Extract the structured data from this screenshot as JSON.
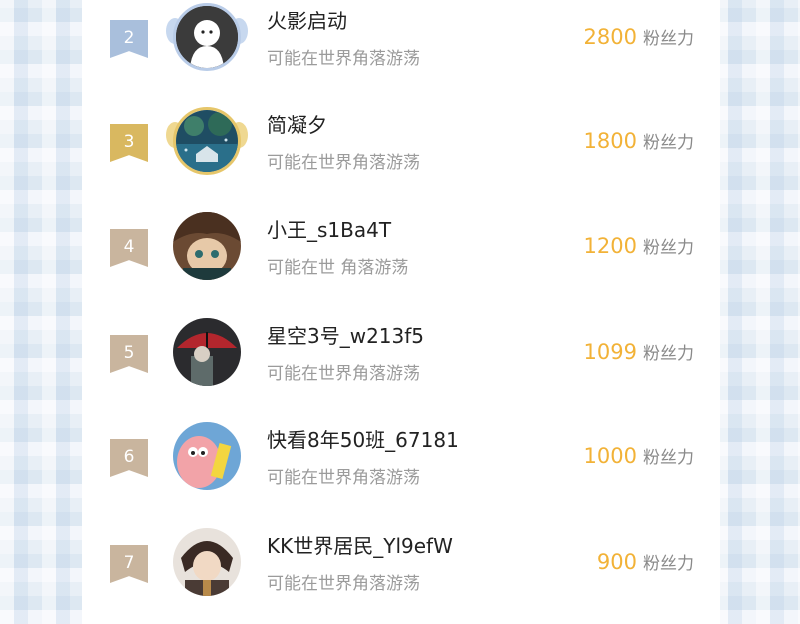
{
  "colors": {
    "accent_gold": "#f2b237",
    "rank_silver": "#a9bfdc",
    "rank_bronze": "#d9b860",
    "rank_other": "#c9b59e"
  },
  "description_text": "可能在世界角落游荡",
  "fans_label": "粉丝力",
  "ranking": [
    {
      "rank": "2",
      "name": "火影启动",
      "description": "可能在世界角落游荡",
      "fans": "2800",
      "fans_label": "粉丝力",
      "avatar_icon": "ghost-avatar-icon"
    },
    {
      "rank": "3",
      "name": "简凝夕",
      "description": "可能在世界角落游荡",
      "fans": "1800",
      "fans_label": "粉丝力",
      "avatar_icon": "scenery-avatar-icon"
    },
    {
      "rank": "4",
      "name": "小王_s1Ba4T",
      "description": "可能在世 角落游荡",
      "fans": "1200",
      "fans_label": "粉丝力",
      "avatar_icon": "anime-character-avatar-icon"
    },
    {
      "rank": "5",
      "name": "星空3号_w213f5",
      "description": "可能在世界角落游荡",
      "fans": "1099",
      "fans_label": "粉丝力",
      "avatar_icon": "umbrella-avatar-icon"
    },
    {
      "rank": "6",
      "name": "快看8年50班_67181",
      "description": "可能在世界角落游荡",
      "fans": "1000",
      "fans_label": "粉丝力",
      "avatar_icon": "starfish-avatar-icon"
    },
    {
      "rank": "7",
      "name": "KK世界居民_Yl9efW",
      "description": "可能在世界角落游荡",
      "fans": "900",
      "fans_label": "粉丝力",
      "avatar_icon": "anime-boy-avatar-icon"
    }
  ]
}
